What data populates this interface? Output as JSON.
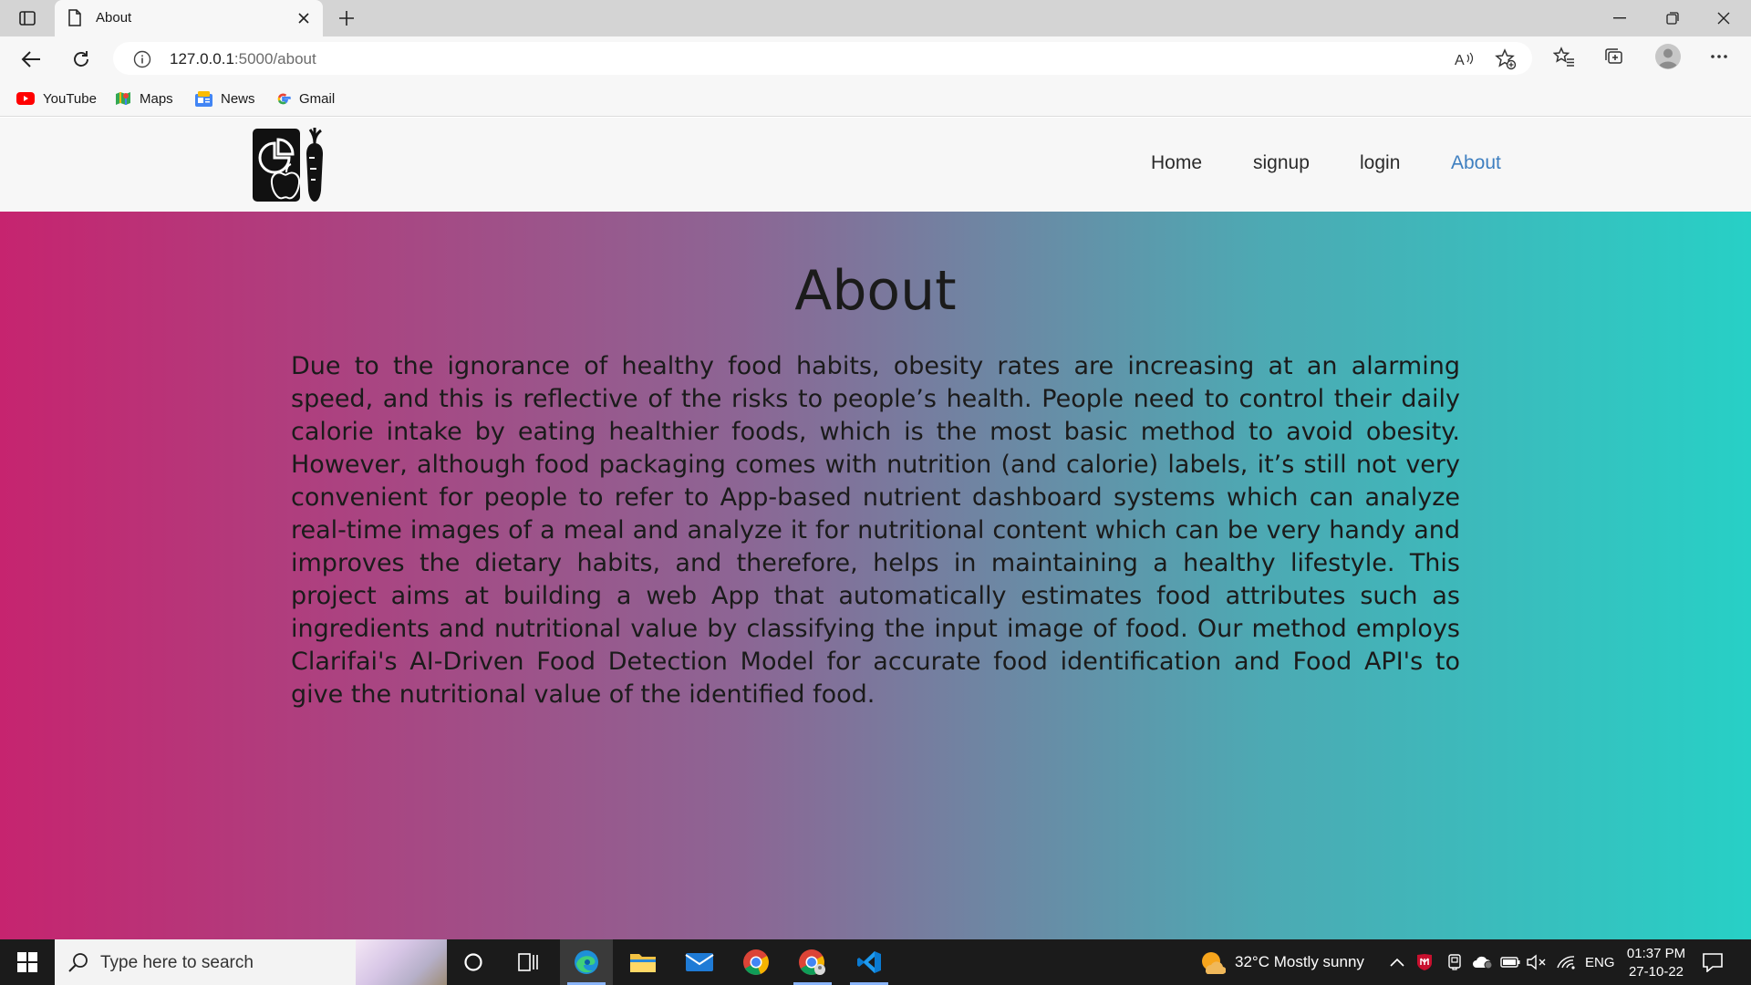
{
  "browser": {
    "tab_title": "About",
    "url_host": "127.0.0.1",
    "url_path": ":5000/about",
    "favorites": [
      {
        "label": "YouTube",
        "icon": "youtube-icon"
      },
      {
        "label": "Maps",
        "icon": "maps-icon"
      },
      {
        "label": "News",
        "icon": "news-icon"
      },
      {
        "label": "Gmail",
        "icon": "google-icon"
      }
    ]
  },
  "site": {
    "logo_icon": "nutrition-app-logo",
    "nav": {
      "home": "Home",
      "signup": "signup",
      "login": "login",
      "about": "About"
    },
    "heading": "About",
    "body": "Due to the ignorance of healthy food habits, obesity rates are increasing at an alarming speed, and this is reflective of the risks to people’s health. People need to control their daily calorie intake by eating healthier foods, which is the most basic method to avoid obesity. However, although food packaging comes with nutrition (and calorie) labels, it’s still not very convenient for people to refer to App-based nutrient dashboard systems which can analyze real-time images of a meal and analyze it for nutritional content which can be very handy and improves the dietary habits, and therefore, helps in maintaining a healthy lifestyle. This project aims at building a web App that automatically estimates food attributes such as ingredients and nutritional value by classifying the input image of food.  Our method employs Clarifai's AI-Driven Food Detection Model for accurate food identification and Food API's to give the nutritional value of the identified food.",
    "colors": {
      "gradient_start": "#c6246f",
      "gradient_end": "#27d0c6",
      "active_link": "#3e7fc0"
    }
  },
  "taskbar": {
    "search_placeholder": "Type here to search",
    "weather": "32°C  Mostly sunny",
    "language": "ENG",
    "time": "01:37 PM",
    "date": "27-10-22"
  }
}
